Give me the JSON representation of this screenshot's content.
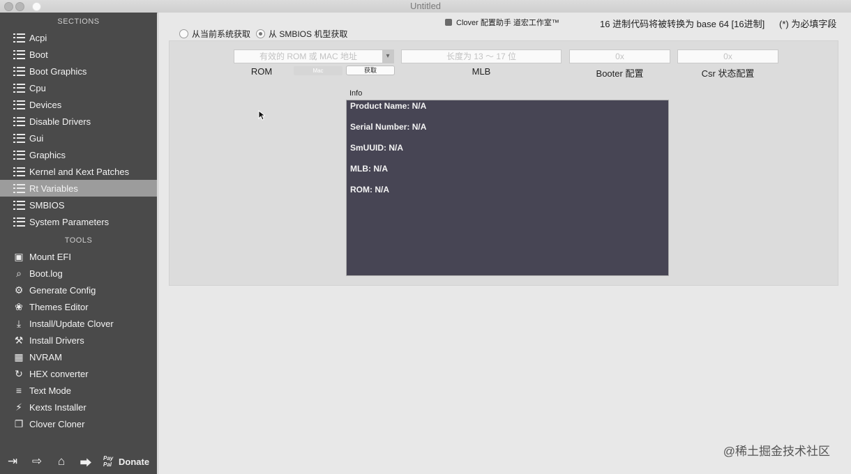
{
  "window": {
    "title": "Untitled"
  },
  "sidebar": {
    "sections_header": "SECTIONS",
    "sections": [
      {
        "label": "Acpi",
        "icon": "list-icon"
      },
      {
        "label": "Boot",
        "icon": "list-icon"
      },
      {
        "label": "Boot Graphics",
        "icon": "list-icon"
      },
      {
        "label": "Cpu",
        "icon": "list-icon"
      },
      {
        "label": "Devices",
        "icon": "list-icon"
      },
      {
        "label": "Disable Drivers",
        "icon": "list-icon"
      },
      {
        "label": "Gui",
        "icon": "list-icon"
      },
      {
        "label": "Graphics",
        "icon": "list-icon"
      },
      {
        "label": "Kernel and Kext Patches",
        "icon": "list-icon"
      },
      {
        "label": "Rt Variables",
        "icon": "list-icon",
        "selected": true
      },
      {
        "label": "SMBIOS",
        "icon": "list-icon"
      },
      {
        "label": "System Parameters",
        "icon": "list-icon"
      }
    ],
    "tools_header": "TOOLS",
    "tools": [
      {
        "label": "Mount EFI",
        "icon": "disk-icon"
      },
      {
        "label": "Boot.log",
        "icon": "log-search-icon"
      },
      {
        "label": "Generate Config",
        "icon": "gears-icon"
      },
      {
        "label": "Themes Editor",
        "icon": "palette-icon"
      },
      {
        "label": "Install/Update Clover",
        "icon": "download-icon"
      },
      {
        "label": "Install Drivers",
        "icon": "tools-icon"
      },
      {
        "label": "NVRAM",
        "icon": "chip-icon"
      },
      {
        "label": "HEX converter",
        "icon": "convert-icon"
      },
      {
        "label": "Text Mode",
        "icon": "text-lines-icon"
      },
      {
        "label": "Kexts Installer",
        "icon": "plug-icon"
      },
      {
        "label": "Clover Cloner",
        "icon": "clone-icon"
      }
    ],
    "bottom": {
      "donate_label": "Donate",
      "paypal_top": "Pay",
      "paypal_bottom": "Pal"
    }
  },
  "main": {
    "radio_current": "从当前系统获取",
    "radio_smbios": "从 SMBIOS 机型获取",
    "clover_helper": "Clover 配置助手 道宏工作室™",
    "hex_note": "16 进制代码将被转换为 base 64 [16进制]",
    "required_note": "(*) 为必填字段",
    "rom_placeholder": "有效的 ROM 或 MAC 地址",
    "rom_label": "ROM",
    "mac_segment": "Mac",
    "fetch_button": "获取",
    "mlb_placeholder": "长度为 13 ～ 17 位",
    "mlb_label": "MLB",
    "booter_placeholder": "0x",
    "booter_label": "Booter 配置",
    "csr_placeholder": "0x",
    "csr_label": "Csr 状态配置",
    "info_title": "Info",
    "info_lines": [
      "Product Name: N/A",
      "Serial Number: N/A",
      "SmUUID: N/A",
      "MLB: N/A",
      "ROM: N/A"
    ]
  },
  "watermark": "@稀土掘金技术社区"
}
